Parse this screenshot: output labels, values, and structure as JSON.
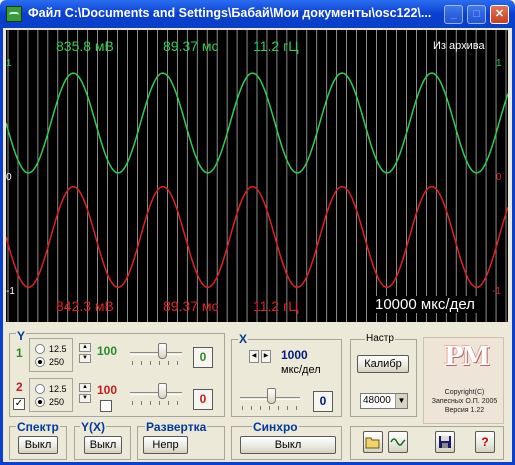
{
  "window": {
    "title": "Файл C:\\Documents and Settings\\Бабай\\Мои документы\\osc122\\...",
    "minimize": "_",
    "maximize": "□",
    "close": "✕"
  },
  "scope": {
    "ch1": {
      "amplitude": "835.8 мВ",
      "period": "89.37 мс",
      "frequency": "11.2 гЦ",
      "marker": "1"
    },
    "ch2": {
      "amplitude": "842.3 мВ",
      "period": "89.37 мс",
      "frequency": "11.2 гЦ",
      "marker": "-1"
    },
    "source": "Из архива",
    "zero_marker": "0",
    "timebase": "10000 мкс/дел",
    "colors": {
      "ch1": "#33cc55",
      "ch2": "#dd2222",
      "grid": "#c8c8c8",
      "background": "#000000"
    }
  },
  "chart_data": {
    "type": "line",
    "title": "",
    "xlabel": "",
    "ylabel": "",
    "x_divisions": 50,
    "ylim": [
      -1,
      1
    ],
    "series": [
      {
        "name": "",
        "amplitude": 0.835,
        "cycles_on_screen": 5.6,
        "offset_div": 0.5,
        "color": "#33cc55"
      },
      {
        "name": "",
        "amplitude": 0.842,
        "cycles_on_screen": 5.6,
        "offset_div": -0.5,
        "color": "#dd2222"
      }
    ]
  },
  "controls": {
    "y": {
      "label": "Y",
      "ch1": {
        "num": "1",
        "range_a": "12.5",
        "range_b": "250",
        "gain": "100",
        "offset": "0"
      },
      "ch2": {
        "num": "2",
        "range_a": "12.5",
        "range_b": "250",
        "gain": "100",
        "offset": "0"
      }
    },
    "x": {
      "label": "X",
      "value": "1000",
      "unit": "мкс/дел",
      "offset": "0"
    },
    "setup": {
      "label": "Настр",
      "calibrate": "Калибр",
      "rate": "48000"
    },
    "spectrum": {
      "label": "Спектр",
      "button": "Выкл"
    },
    "yx": {
      "label": "Y(X)",
      "button": "Выкл"
    },
    "sweep": {
      "label": "Развертка",
      "button": "Непр"
    },
    "sync": {
      "label": "Синхро",
      "button": "Выкл"
    },
    "about": {
      "copyright": "Copyright(C)",
      "author": "Запесных О.П. 2005",
      "version": "Версия 1.22",
      "logo": "PM"
    },
    "help": "?"
  }
}
